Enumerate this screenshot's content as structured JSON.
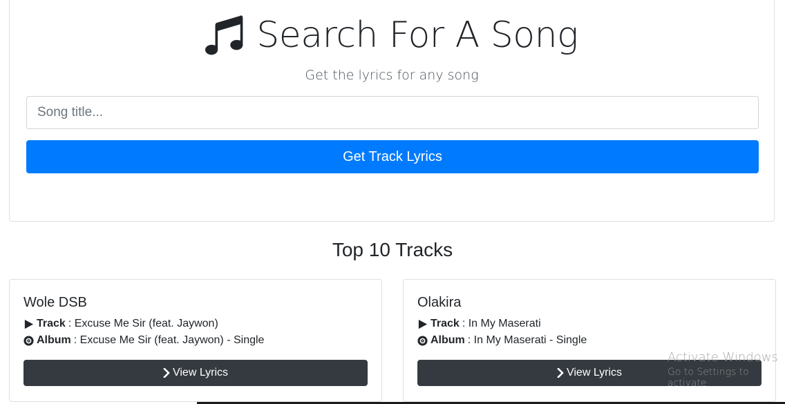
{
  "header": {
    "title": "Search For A Song",
    "subtitle": "Get the lyrics for any song",
    "icon": "music-note-icon"
  },
  "search": {
    "placeholder": "Song title...",
    "value": "",
    "button_label": "Get Track Lyrics"
  },
  "top_tracks": {
    "heading": "Top 10 Tracks",
    "items": [
      {
        "artist": "Wole DSB",
        "track_label": "Track",
        "track": ": Excuse Me Sir (feat. Jaywon)",
        "album_label": "Album",
        "album": ": Excuse Me Sir (feat. Jaywon) - Single",
        "button_label": "View Lyrics"
      },
      {
        "artist": "Olakira",
        "track_label": "Track",
        "track": ": In My Maserati",
        "album_label": "Album",
        "album": ": In My Maserati - Single",
        "button_label": "View Lyrics"
      }
    ]
  },
  "watermark": {
    "title": "Activate Windows",
    "subtitle": "Go to Settings to activate"
  },
  "colors": {
    "primary": "#007bff",
    "dark": "#343a40",
    "text": "#212529",
    "border": "#dfdfdf"
  }
}
